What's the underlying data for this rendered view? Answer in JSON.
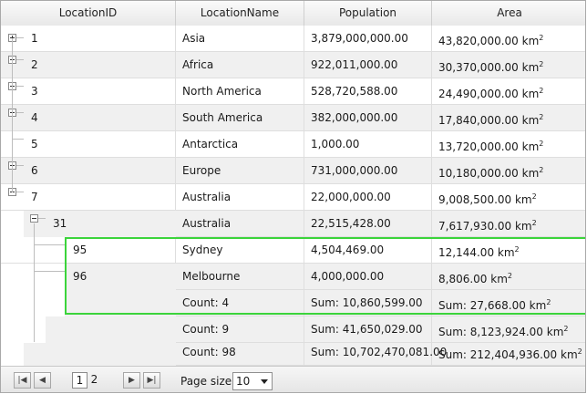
{
  "columns": [
    "LocationID",
    "LocationName",
    "Population",
    "Area"
  ],
  "area_unit": "km",
  "area_exp": "2",
  "rows": [
    {
      "id": "1",
      "name": "Asia",
      "population": "3,879,000,000.00",
      "area": "43,820,000.00"
    },
    {
      "id": "2",
      "name": "Africa",
      "population": "922,011,000.00",
      "area": "30,370,000.00"
    },
    {
      "id": "3",
      "name": "North America",
      "population": "528,720,588.00",
      "area": "24,490,000.00"
    },
    {
      "id": "4",
      "name": "South America",
      "population": "382,000,000.00",
      "area": "17,840,000.00"
    },
    {
      "id": "5",
      "name": "Antarctica",
      "population": "1,000.00",
      "area": "13,720,000.00"
    },
    {
      "id": "6",
      "name": "Europe",
      "population": "731,000,000.00",
      "area": "10,180,000.00"
    },
    {
      "id": "7",
      "name": "Australia",
      "population": "22,000,000.00",
      "area": "9,008,500.00"
    },
    {
      "id": "31",
      "name": "Australia",
      "population": "22,515,428.00",
      "area": "7,617,930.00"
    },
    {
      "id": "95",
      "name": "Sydney",
      "population": "4,504,469.00",
      "area": "12,144.00"
    },
    {
      "id": "96",
      "name": "Melbourne",
      "population": "4,000,000.00",
      "area": "8,806.00"
    }
  ],
  "summaries": [
    {
      "count": "Count: 4",
      "pop_sum": "Sum: 10,860,599.00",
      "area_sum": "Sum: 27,668.00"
    },
    {
      "count": "Count: 9",
      "pop_sum": "Sum: 41,650,029.00",
      "area_sum": "Sum: 8,123,924.00"
    },
    {
      "count": "Count: 98",
      "pop_sum": "Sum: 10,702,470,081.00",
      "area_sum": "Sum: 212,404,936.00"
    }
  ],
  "pager": {
    "pages": [
      "1",
      "2"
    ],
    "current_page": "1",
    "page_size_label": "Page size:",
    "page_size": "10"
  },
  "colors": {
    "selection": "#3bd43b",
    "alt_row": "#f0f0f0"
  }
}
